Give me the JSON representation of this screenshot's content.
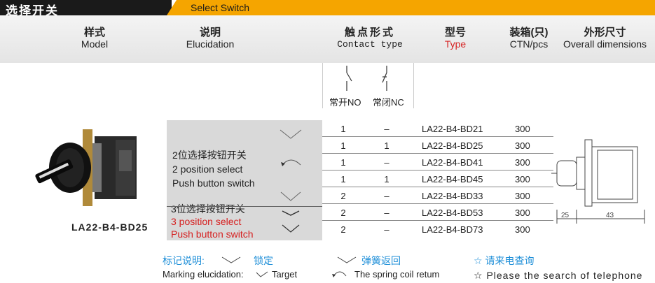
{
  "title": {
    "cn": "选择开关",
    "en": "Select Switch"
  },
  "header": {
    "model": {
      "cn": "样式",
      "en": "Model"
    },
    "elucidation": {
      "cn": "说明",
      "en": "Elucidation"
    },
    "contact": {
      "cn": "触点形式",
      "en": "Contact type"
    },
    "type": {
      "cn": "型号",
      "en": "Type"
    },
    "ctn": {
      "cn": "装箱(只)",
      "en": "CTN/pcs"
    },
    "dimensions": {
      "cn": "外形尺寸",
      "en": "Overall dimensions"
    }
  },
  "contacts": {
    "no_label": "常开NO",
    "nc_label": "常闭NC"
  },
  "description": {
    "group1": {
      "cn": "2位选择按钮开关",
      "en1": "2 position select",
      "en2": "Push button switch"
    },
    "group2": {
      "cn": "3位选择按钮开关",
      "en1": "3 position select",
      "en2": "Push button switch"
    }
  },
  "rows": [
    {
      "no": "1",
      "nc": "–",
      "type": "LA22-B4-BD21",
      "ctn": "300"
    },
    {
      "no": "1",
      "nc": "1",
      "type": "LA22-B4-BD25",
      "ctn": "300"
    },
    {
      "no": "1",
      "nc": "–",
      "type": "LA22-B4-BD41",
      "ctn": "300"
    },
    {
      "no": "1",
      "nc": "1",
      "type": "LA22-B4-BD45",
      "ctn": "300"
    },
    {
      "no": "2",
      "nc": "–",
      "type": "LA22-B4-BD33",
      "ctn": "300"
    },
    {
      "no": "2",
      "nc": "–",
      "type": "LA22-B4-BD53",
      "ctn": "300"
    },
    {
      "no": "2",
      "nc": "–",
      "type": "LA22-B4-BD73",
      "ctn": "300"
    }
  ],
  "product_label": "LA22-B4-BD25",
  "dimensions": {
    "d1": "25",
    "d2": "43"
  },
  "footer": {
    "marking_cn": "标记说明:",
    "lock_cn": "锁定",
    "spring_cn": "弹簧返回",
    "inquire_cn": "☆ 请来电查询",
    "marking_en": "Marking elucidation:",
    "target_en": "Target",
    "spring_en": "The spring coil retum",
    "inquire_en": "☆ Please the search of telephone"
  }
}
